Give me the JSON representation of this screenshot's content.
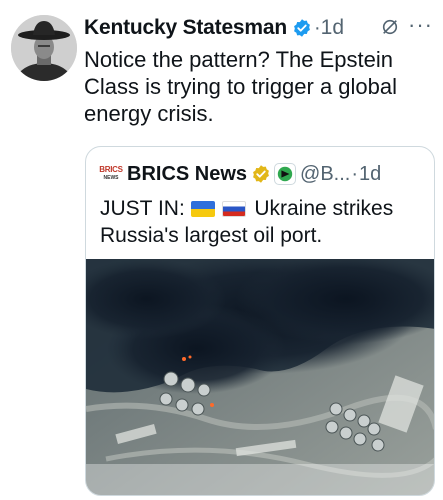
{
  "tweet": {
    "author_name": "Kentucky Statesman",
    "time": "1d",
    "separator": "·",
    "more_glyph": "···",
    "text": "Notice the pattern? The Epstein Class is trying to trigger a global energy crisis."
  },
  "quote": {
    "logo_line1": "BRICS",
    "logo_line2": "NEWS",
    "author_name": "BRICS News",
    "handle": "@B...",
    "separator": "·",
    "time": "1d",
    "text_prefix": "JUST IN:",
    "text_suffix": "Ukraine strikes Russia's largest oil port."
  },
  "colors": {
    "verified_blue": "#1d9bf0",
    "verified_gold": "#e2b719",
    "secondary_text": "#536471"
  }
}
